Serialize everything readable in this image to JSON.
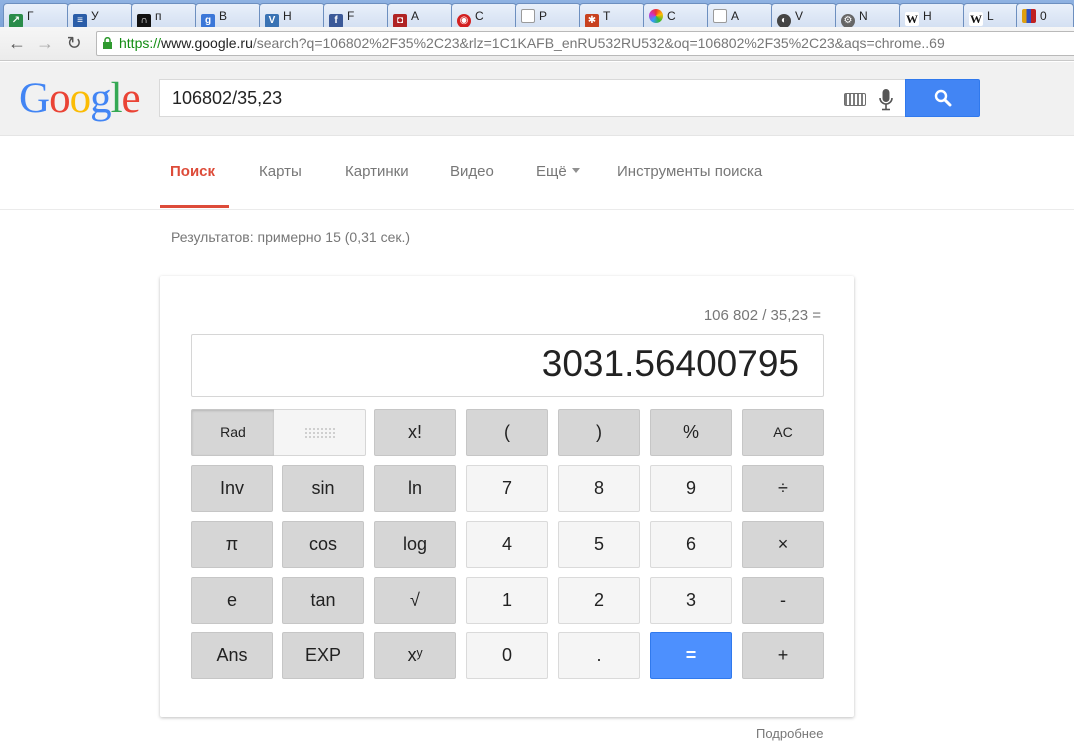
{
  "browser": {
    "tabs": [
      {
        "label": "Г",
        "icon": "chart-icon",
        "color": "#2a8c4a"
      },
      {
        "label": "У",
        "icon": "doc-list-icon",
        "color": "#2a5da8"
      },
      {
        "label": "п",
        "icon": "headphones-icon",
        "color": "#111111"
      },
      {
        "label": "В",
        "icon": "google-plus-icon",
        "color": "#3b77d8"
      },
      {
        "label": "Н",
        "icon": "v-logo-icon",
        "color": "#3a73b4"
      },
      {
        "label": "F",
        "icon": "facebook-icon",
        "color": "#3b5998"
      },
      {
        "label": "А",
        "icon": "car-icon",
        "color": "#b02323"
      },
      {
        "label": "С",
        "icon": "target-icon",
        "color": "#d32020"
      },
      {
        "label": "Р",
        "icon": "page-icon",
        "color": "#9a9a9a"
      },
      {
        "label": "Т",
        "icon": "puzzle-icon",
        "color": "#c8411e"
      },
      {
        "label": "С",
        "icon": "color-wheel-icon",
        "color": "#d44f9a"
      },
      {
        "label": "А",
        "icon": "page-icon",
        "color": "#9a9a9a"
      },
      {
        "label": "V",
        "icon": "globe-icon",
        "color": "#444444"
      },
      {
        "label": "N",
        "icon": "gear-icon",
        "color": "#666666"
      },
      {
        "label": "Н",
        "icon": "wikipedia-icon",
        "color": "#222222"
      },
      {
        "label": "L",
        "icon": "wikipedia-icon",
        "color": "#222222"
      },
      {
        "label": "0",
        "icon": "colorbars-icon",
        "color": "#e0a010"
      }
    ],
    "url": {
      "scheme": "https://",
      "host": "www.google.ru",
      "path": "/search?q=106802%2F35%2C23&rlz=1C1KAFB_enRU532RU532&oq=106802%2F35%2C23&aqs=chrome..69"
    }
  },
  "google": {
    "logo": [
      "G",
      "o",
      "o",
      "g",
      "l",
      "e"
    ],
    "logo_colors": [
      "#4285f4",
      "#ea4335",
      "#fbbc05",
      "#4285f4",
      "#34a853",
      "#ea4335"
    ],
    "query": "106802/35,23",
    "nav": {
      "search": "Поиск",
      "maps": "Карты",
      "images": "Картинки",
      "video": "Видео",
      "more": "Ещё",
      "tools": "Инструменты поиска"
    },
    "result_stats": "Результатов: примерно 15 (0,31 сек.)",
    "more_link": "Подробнее"
  },
  "calculator": {
    "expression": "106 802 / 35,23 =",
    "display": "3031.56400795",
    "keys": {
      "rad": "Rad",
      "fact": "x!",
      "lparen": "(",
      "rparen": ")",
      "percent": "%",
      "ac": "AC",
      "inv": "Inv",
      "sin": "sin",
      "ln": "ln",
      "seven": "7",
      "eight": "8",
      "nine": "9",
      "divide": "÷",
      "pi": "π",
      "cos": "cos",
      "log": "log",
      "four": "4",
      "five": "5",
      "six": "6",
      "multiply": "×",
      "e": "e",
      "tan": "tan",
      "sqrt": "√",
      "one": "1",
      "two": "2",
      "three": "3",
      "minus": "-",
      "ans": "Ans",
      "exp": "EXP",
      "pow": "xʸ",
      "zero": "0",
      "dot": ".",
      "equals": "=",
      "plus": "+"
    }
  }
}
